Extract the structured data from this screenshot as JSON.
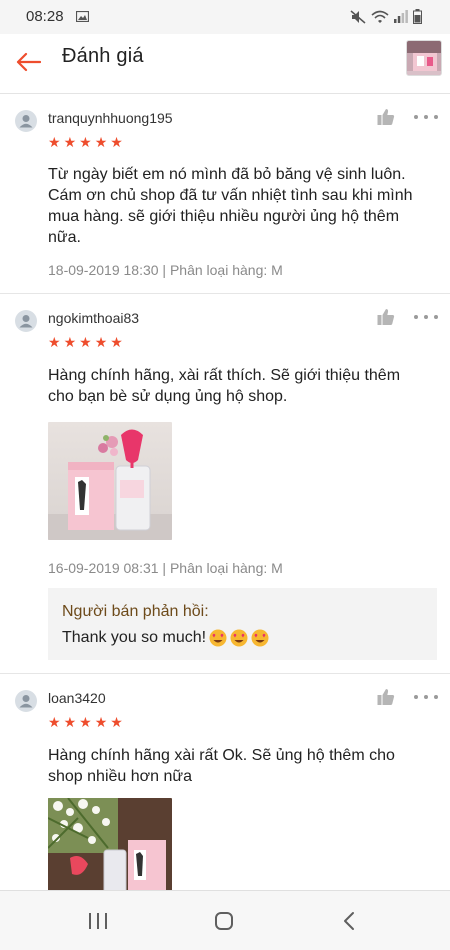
{
  "status_bar": {
    "time": "08:28"
  },
  "header": {
    "title": "Đánh giá"
  },
  "colors": {
    "accent": "#ee4d2d",
    "reply_title": "#6d4a1a",
    "meta": "#8a8a8a"
  },
  "reviews": [
    {
      "username": "tranquynhhuong195",
      "rating": 5,
      "text_lines": [
        "Từ ngày biết em nó mình đã bỏ băng vệ sinh luôn.",
        "Cám ơn chủ shop đã tư vấn nhiệt tình sau khi mình",
        "mua hàng. sẽ giới thiệu nhiều người ủng hộ thêm",
        "nữa."
      ],
      "meta": "18-09-2019 18:30 | Phân loại hàng: M"
    },
    {
      "username": "ngokimthoai83",
      "rating": 5,
      "text_lines": [
        "Hàng chính hãng, xài rất thích. Sẽ giới thiệu thêm",
        "cho bạn bè sử dụng ủng hộ shop."
      ],
      "meta": "16-09-2019 08:31 | Phân loại hàng: M",
      "seller_reply": {
        "title": "Người bán phản hồi:",
        "text": "Thank you so much!"
      }
    },
    {
      "username": "loan3420",
      "rating": 5,
      "text_lines": [
        "Hàng chính hãng xài rất Ok. Sẽ ủng hộ thêm cho",
        "shop nhiều hơn nữa"
      ]
    }
  ]
}
